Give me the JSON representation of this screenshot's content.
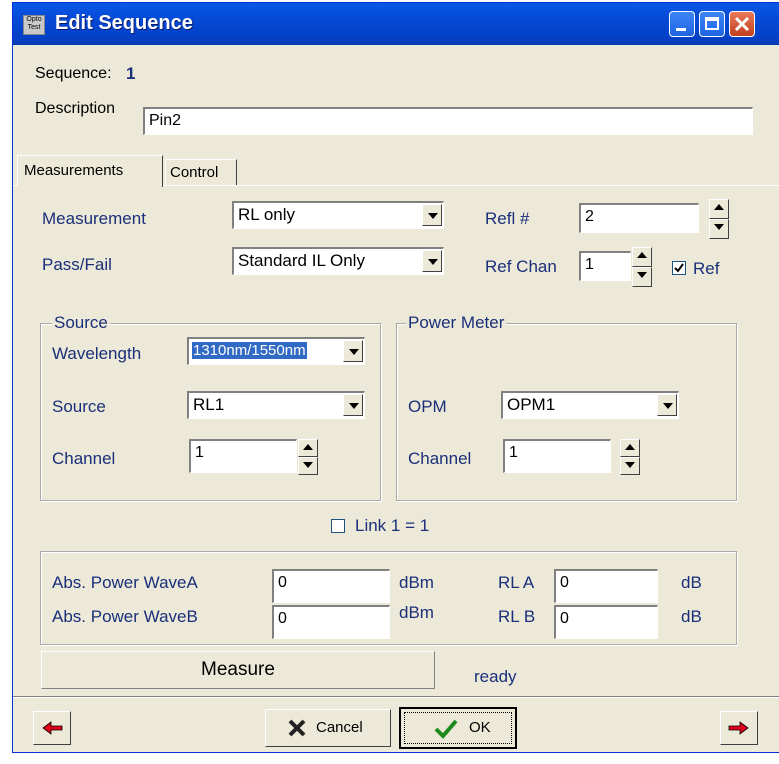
{
  "window": {
    "title": "Edit Sequence",
    "icon_text_top": "Opto",
    "icon_text_bottom": "Test"
  },
  "sequence": {
    "label": "Sequence:",
    "value": "1"
  },
  "description": {
    "label": "Description",
    "value": "Pin2"
  },
  "tabs": [
    {
      "label": "Measurements",
      "active": true
    },
    {
      "label": "Control",
      "active": false
    }
  ],
  "measurement": {
    "label": "Measurement",
    "value": "RL only"
  },
  "pass_fail": {
    "label": "Pass/Fail",
    "value": "Standard IL Only"
  },
  "refl": {
    "label": "Refl #",
    "value": "2"
  },
  "ref_chan": {
    "label": "Ref Chan",
    "value": "1"
  },
  "ref_check": {
    "label": "Ref",
    "checked": true
  },
  "source_group": {
    "title": "Source",
    "wavelength_label": "Wavelength",
    "wavelength_value": "1310nm/1550nm",
    "source_label": "Source",
    "source_value": "RL1",
    "channel_label": "Channel",
    "channel_value": "1"
  },
  "power_meter_group": {
    "title": "Power Meter",
    "opm_label": "OPM",
    "opm_value": "OPM1",
    "channel_label": "Channel",
    "channel_value": "1"
  },
  "link": {
    "label": "Link 1 = 1",
    "checked": false
  },
  "readings": {
    "abs_wave_a_label": "Abs. Power WaveA",
    "abs_wave_a_value": "0",
    "abs_wave_a_unit": "dBm",
    "abs_wave_b_label": "Abs. Power WaveB",
    "abs_wave_b_value": "0",
    "abs_wave_b_unit": "dBm",
    "rl_a_label": "RL A",
    "rl_a_value": "0",
    "rl_a_unit": "dB",
    "rl_b_label": "RL B",
    "rl_b_value": "0",
    "rl_b_unit": "dB"
  },
  "measure_button": "Measure",
  "status": "ready",
  "footer": {
    "cancel_label": "Cancel",
    "ok_label": "OK"
  },
  "colors": {
    "title_bar": "#0549d4",
    "label_blue": "#1a2f7a",
    "face": "#ece9d8",
    "arrow_red": "#e0001b",
    "check_green": "#1c8a1c"
  },
  "icons": [
    "app-icon",
    "minimize-icon",
    "maximize-icon",
    "close-icon",
    "left-arrow-icon",
    "right-arrow-icon",
    "cancel-x-icon",
    "ok-check-icon"
  ]
}
